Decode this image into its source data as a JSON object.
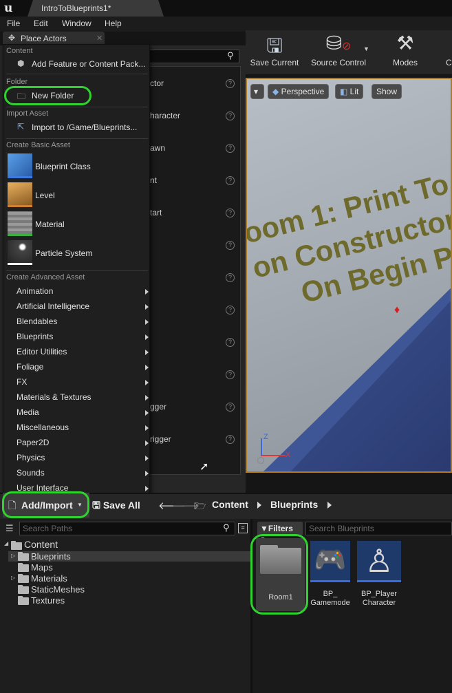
{
  "window": {
    "tab_title": "IntroToBlueprints1*"
  },
  "menubar": {
    "items": [
      "File",
      "Edit",
      "Window",
      "Help"
    ]
  },
  "place_actors": {
    "tab_label": "Place Actors",
    "rows": [
      "ctor",
      "haracter",
      "awn",
      "nt",
      "tart",
      "",
      "",
      "",
      "",
      "",
      "gger",
      "rigger"
    ]
  },
  "toolbar": {
    "save_current": "Save Current",
    "source_control": "Source Control",
    "modes": "Modes",
    "cut": "C"
  },
  "viewport": {
    "perspective": "Perspective",
    "lit": "Lit",
    "show": "Show",
    "text_lines": [
      "oom 1: Print To",
      "on Constructor a",
      "On Begin Pla"
    ],
    "axis_z": "Z",
    "axis_x": "X"
  },
  "dropdown": {
    "sections": {
      "content": "Content",
      "folder": "Folder",
      "import": "Import Asset",
      "basic": "Create Basic Asset",
      "advanced": "Create Advanced Asset"
    },
    "add_feature": "Add Feature or Content Pack...",
    "new_folder": "New Folder",
    "import_to": "Import to /Game/Blueprints...",
    "basic_assets": [
      "Blueprint Class",
      "Level",
      "Material",
      "Particle System"
    ],
    "advanced_assets": [
      "Animation",
      "Artificial Intelligence",
      "Blendables",
      "Blueprints",
      "Editor Utilities",
      "Foliage",
      "FX",
      "Materials & Textures",
      "Media",
      "Miscellaneous",
      "Paper2D",
      "Physics",
      "Sounds",
      "User Interface"
    ]
  },
  "content_browser": {
    "add_import": "Add/Import",
    "save_all": "Save All",
    "path": [
      "Content",
      "Blueprints"
    ],
    "search_paths_placeholder": "Search Paths",
    "filters": "Filters",
    "search_assets_placeholder": "Search Blueprints",
    "tree": {
      "root": "Content",
      "children": [
        "Blueprints",
        "Maps",
        "Materials",
        "StaticMeshes",
        "Textures"
      ]
    },
    "assets": [
      {
        "label_line1": "Room1",
        "label_line2": ""
      },
      {
        "label_line1": "BP_",
        "label_line2": "Gamemode"
      },
      {
        "label_line1": "BP_Player",
        "label_line2": "Character"
      }
    ]
  }
}
